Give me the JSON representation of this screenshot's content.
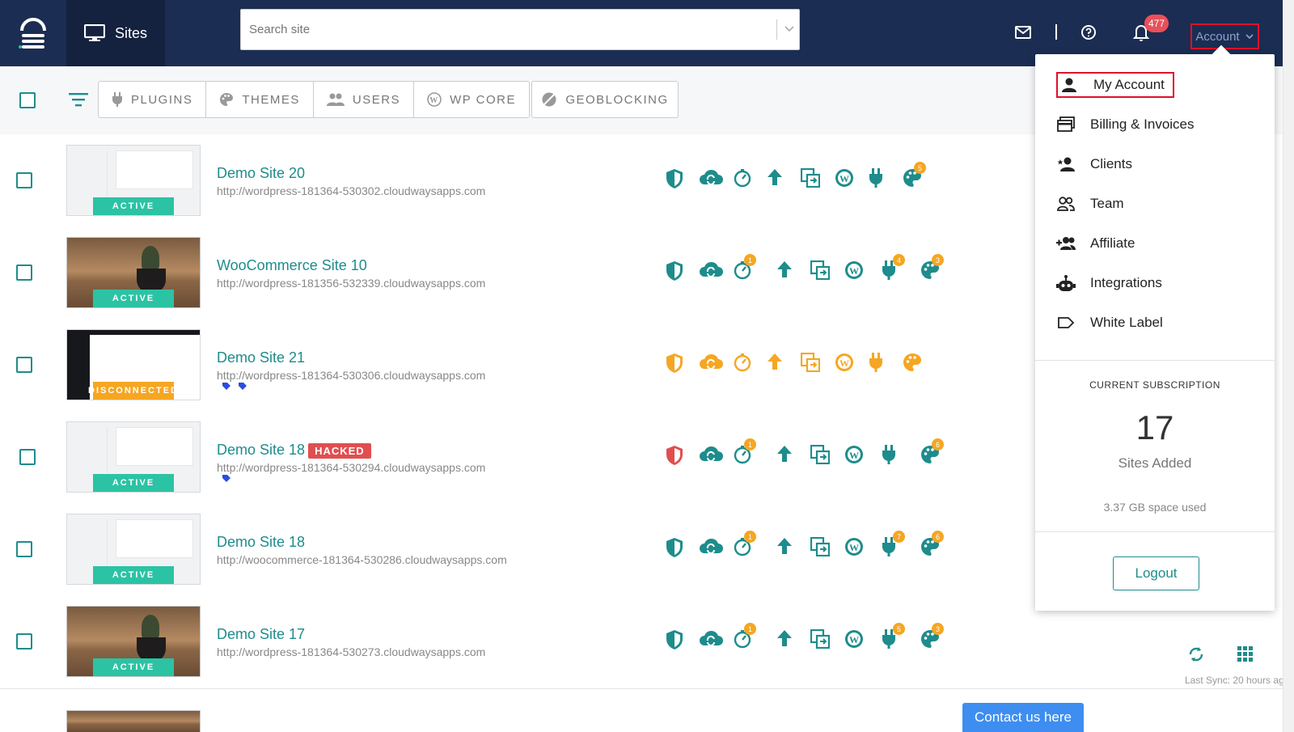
{
  "header": {
    "nav_sites_label": "Sites",
    "search_placeholder": "Search site",
    "notification_count": "477",
    "account_label": "Account"
  },
  "toolbar": {
    "tabs": [
      {
        "label": "PLUGINS",
        "icon": "plug-icon"
      },
      {
        "label": "THEMES",
        "icon": "palette-icon"
      },
      {
        "label": "USERS",
        "icon": "users-icon"
      },
      {
        "label": "WP CORE",
        "icon": "wordpress-icon"
      }
    ],
    "geoblocking_label": "GEOBLOCKING"
  },
  "sites": [
    {
      "name": "Demo Site 20",
      "url": "http://wordpress-181364-530302.cloudwaysapps.com",
      "status": "ACTIVE",
      "hacked": "",
      "tags": "",
      "counts": {
        "updates": "",
        "plugins": "",
        "themes": "5"
      }
    },
    {
      "name": "WooCommerce Site 10",
      "url": "http://wordpress-181356-532339.cloudwaysapps.com",
      "status": "ACTIVE",
      "hacked": "",
      "tags": "",
      "counts": {
        "updates": "1",
        "plugins": "4",
        "themes": "3"
      }
    },
    {
      "name": "Demo Site 21",
      "url": "http://wordpress-181364-530306.cloudwaysapps.com",
      "status": "DISCONNECTED",
      "hacked": "",
      "tags": "2",
      "counts": {
        "updates": "",
        "plugins": "",
        "themes": ""
      }
    },
    {
      "name": "Demo Site 18",
      "url": "http://wordpress-181364-530294.cloudwaysapps.com",
      "status": "ACTIVE",
      "hacked": "HACKED",
      "tags": "1",
      "counts": {
        "updates": "1",
        "plugins": "",
        "themes": "6"
      }
    },
    {
      "name": "Demo Site 18",
      "url": "http://woocommerce-181364-530286.cloudwaysapps.com",
      "status": "ACTIVE",
      "hacked": "",
      "tags": "",
      "counts": {
        "updates": "1",
        "plugins": "7",
        "themes": "6"
      }
    },
    {
      "name": "Demo Site 17",
      "url": "http://wordpress-181364-530273.cloudwaysapps.com",
      "status": "ACTIVE",
      "hacked": "",
      "tags": "",
      "counts": {
        "updates": "1",
        "plugins": "5",
        "themes": "3"
      }
    }
  ],
  "last_sync": "Last Sync: 20 hours ag",
  "account_menu": {
    "items": [
      {
        "label": "My Account",
        "icon": "person-icon"
      },
      {
        "label": "Billing & Invoices",
        "icon": "billing-icon"
      },
      {
        "label": "Clients",
        "icon": "clients-icon"
      },
      {
        "label": "Team",
        "icon": "team-icon"
      },
      {
        "label": "Affiliate",
        "icon": "affiliate-icon"
      },
      {
        "label": "Integrations",
        "icon": "robot-icon"
      },
      {
        "label": "White Label",
        "icon": "label-icon"
      }
    ],
    "subscription": {
      "title": "CURRENT SUBSCRIPTION",
      "count": "17",
      "count_label": "Sites Added",
      "space": "3.37 GB space used"
    },
    "logout_label": "Logout"
  },
  "contact_label": "Contact us here",
  "colors": {
    "navy": "#1b2d52",
    "teal": "#1e8c8c",
    "orange": "#f5a623",
    "red": "#e04f4f",
    "active_green": "#2bc3a4",
    "highlight": "#e0102a"
  }
}
